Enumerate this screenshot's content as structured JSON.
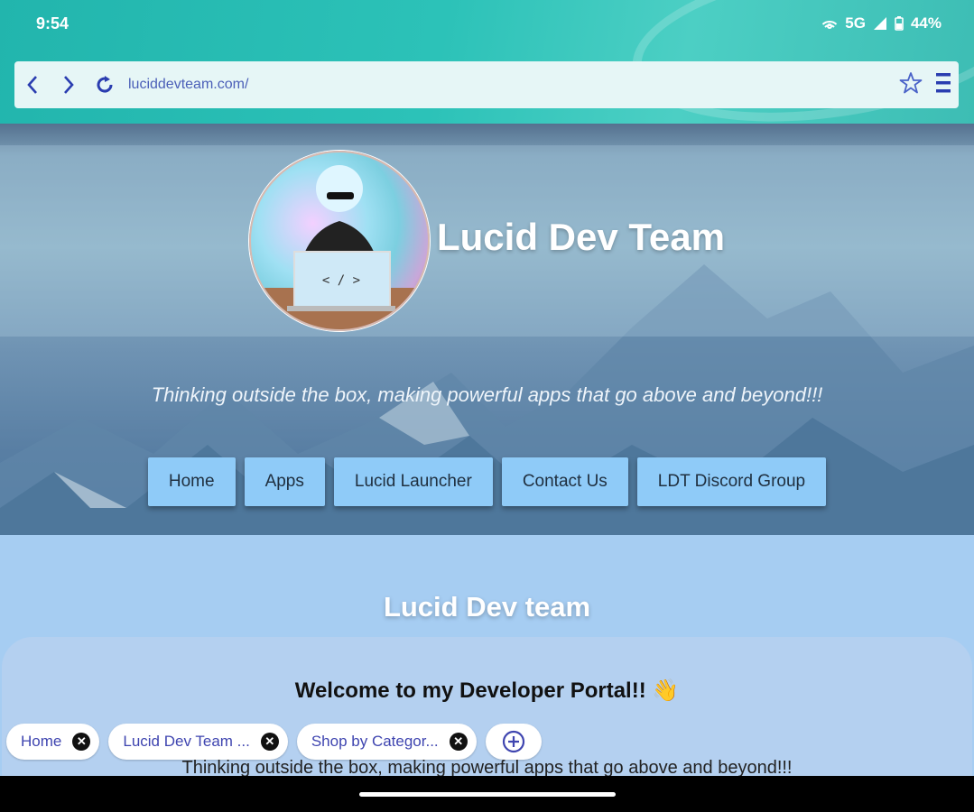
{
  "status": {
    "time": "9:54",
    "network": "5G",
    "battery": "44%"
  },
  "browser": {
    "url": "luciddevteam.com/"
  },
  "hero": {
    "site_title": "Lucid Dev Team",
    "tagline": "Thinking outside the box, making powerful apps that go above and beyond!!!",
    "avatar_label": "< / >"
  },
  "nav": {
    "items": [
      {
        "label": "Home"
      },
      {
        "label": "Apps"
      },
      {
        "label": "Lucid Launcher"
      },
      {
        "label": "Contact Us"
      },
      {
        "label": "LDT Discord Group"
      }
    ]
  },
  "content": {
    "section_title": "Lucid Dev team",
    "welcome": "Welcome to my Developer Portal!!",
    "welcome_emoji": "👋",
    "tagline": "Thinking outside the box, making powerful apps that go above and beyond!!!"
  },
  "tabs": [
    {
      "label": "Home"
    },
    {
      "label": "Lucid Dev Team ..."
    },
    {
      "label": "Shop by Categor..."
    }
  ],
  "colors": {
    "accent": "#2cc2b8",
    "nav_button": "#8fcbf8",
    "link": "#3f45b0"
  }
}
